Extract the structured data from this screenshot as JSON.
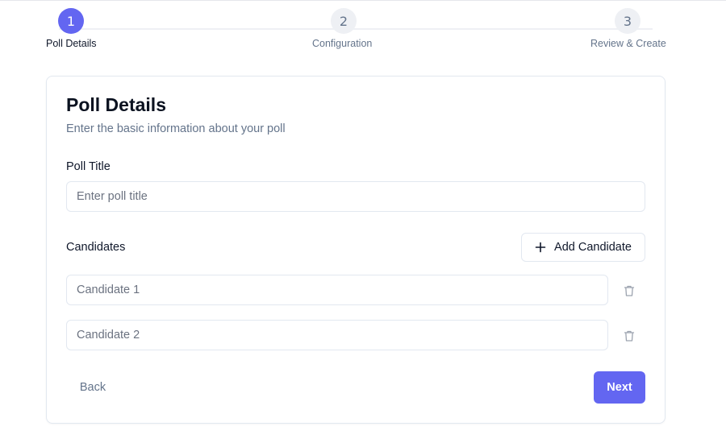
{
  "stepper": {
    "steps": [
      {
        "number": "1",
        "label": "Poll Details",
        "state": "active"
      },
      {
        "number": "2",
        "label": "Configuration",
        "state": "inactive"
      },
      {
        "number": "3",
        "label": "Review & Create",
        "state": "inactive"
      }
    ]
  },
  "card": {
    "title": "Poll Details",
    "subtitle": "Enter the basic information about your poll"
  },
  "form": {
    "poll_title_label": "Poll Title",
    "poll_title_placeholder": "Enter poll title",
    "poll_title_value": "",
    "candidates_label": "Candidates",
    "add_candidate_label": "Add Candidate",
    "candidates": [
      {
        "placeholder": "Candidate 1",
        "value": ""
      },
      {
        "placeholder": "Candidate 2",
        "value": ""
      }
    ]
  },
  "actions": {
    "back_label": "Back",
    "next_label": "Next"
  },
  "icons": {
    "add": "plus-icon",
    "delete": "trash-icon"
  },
  "colors": {
    "accent": "#6366f1",
    "muted_text": "#64748b",
    "border": "#e2e8f0"
  }
}
